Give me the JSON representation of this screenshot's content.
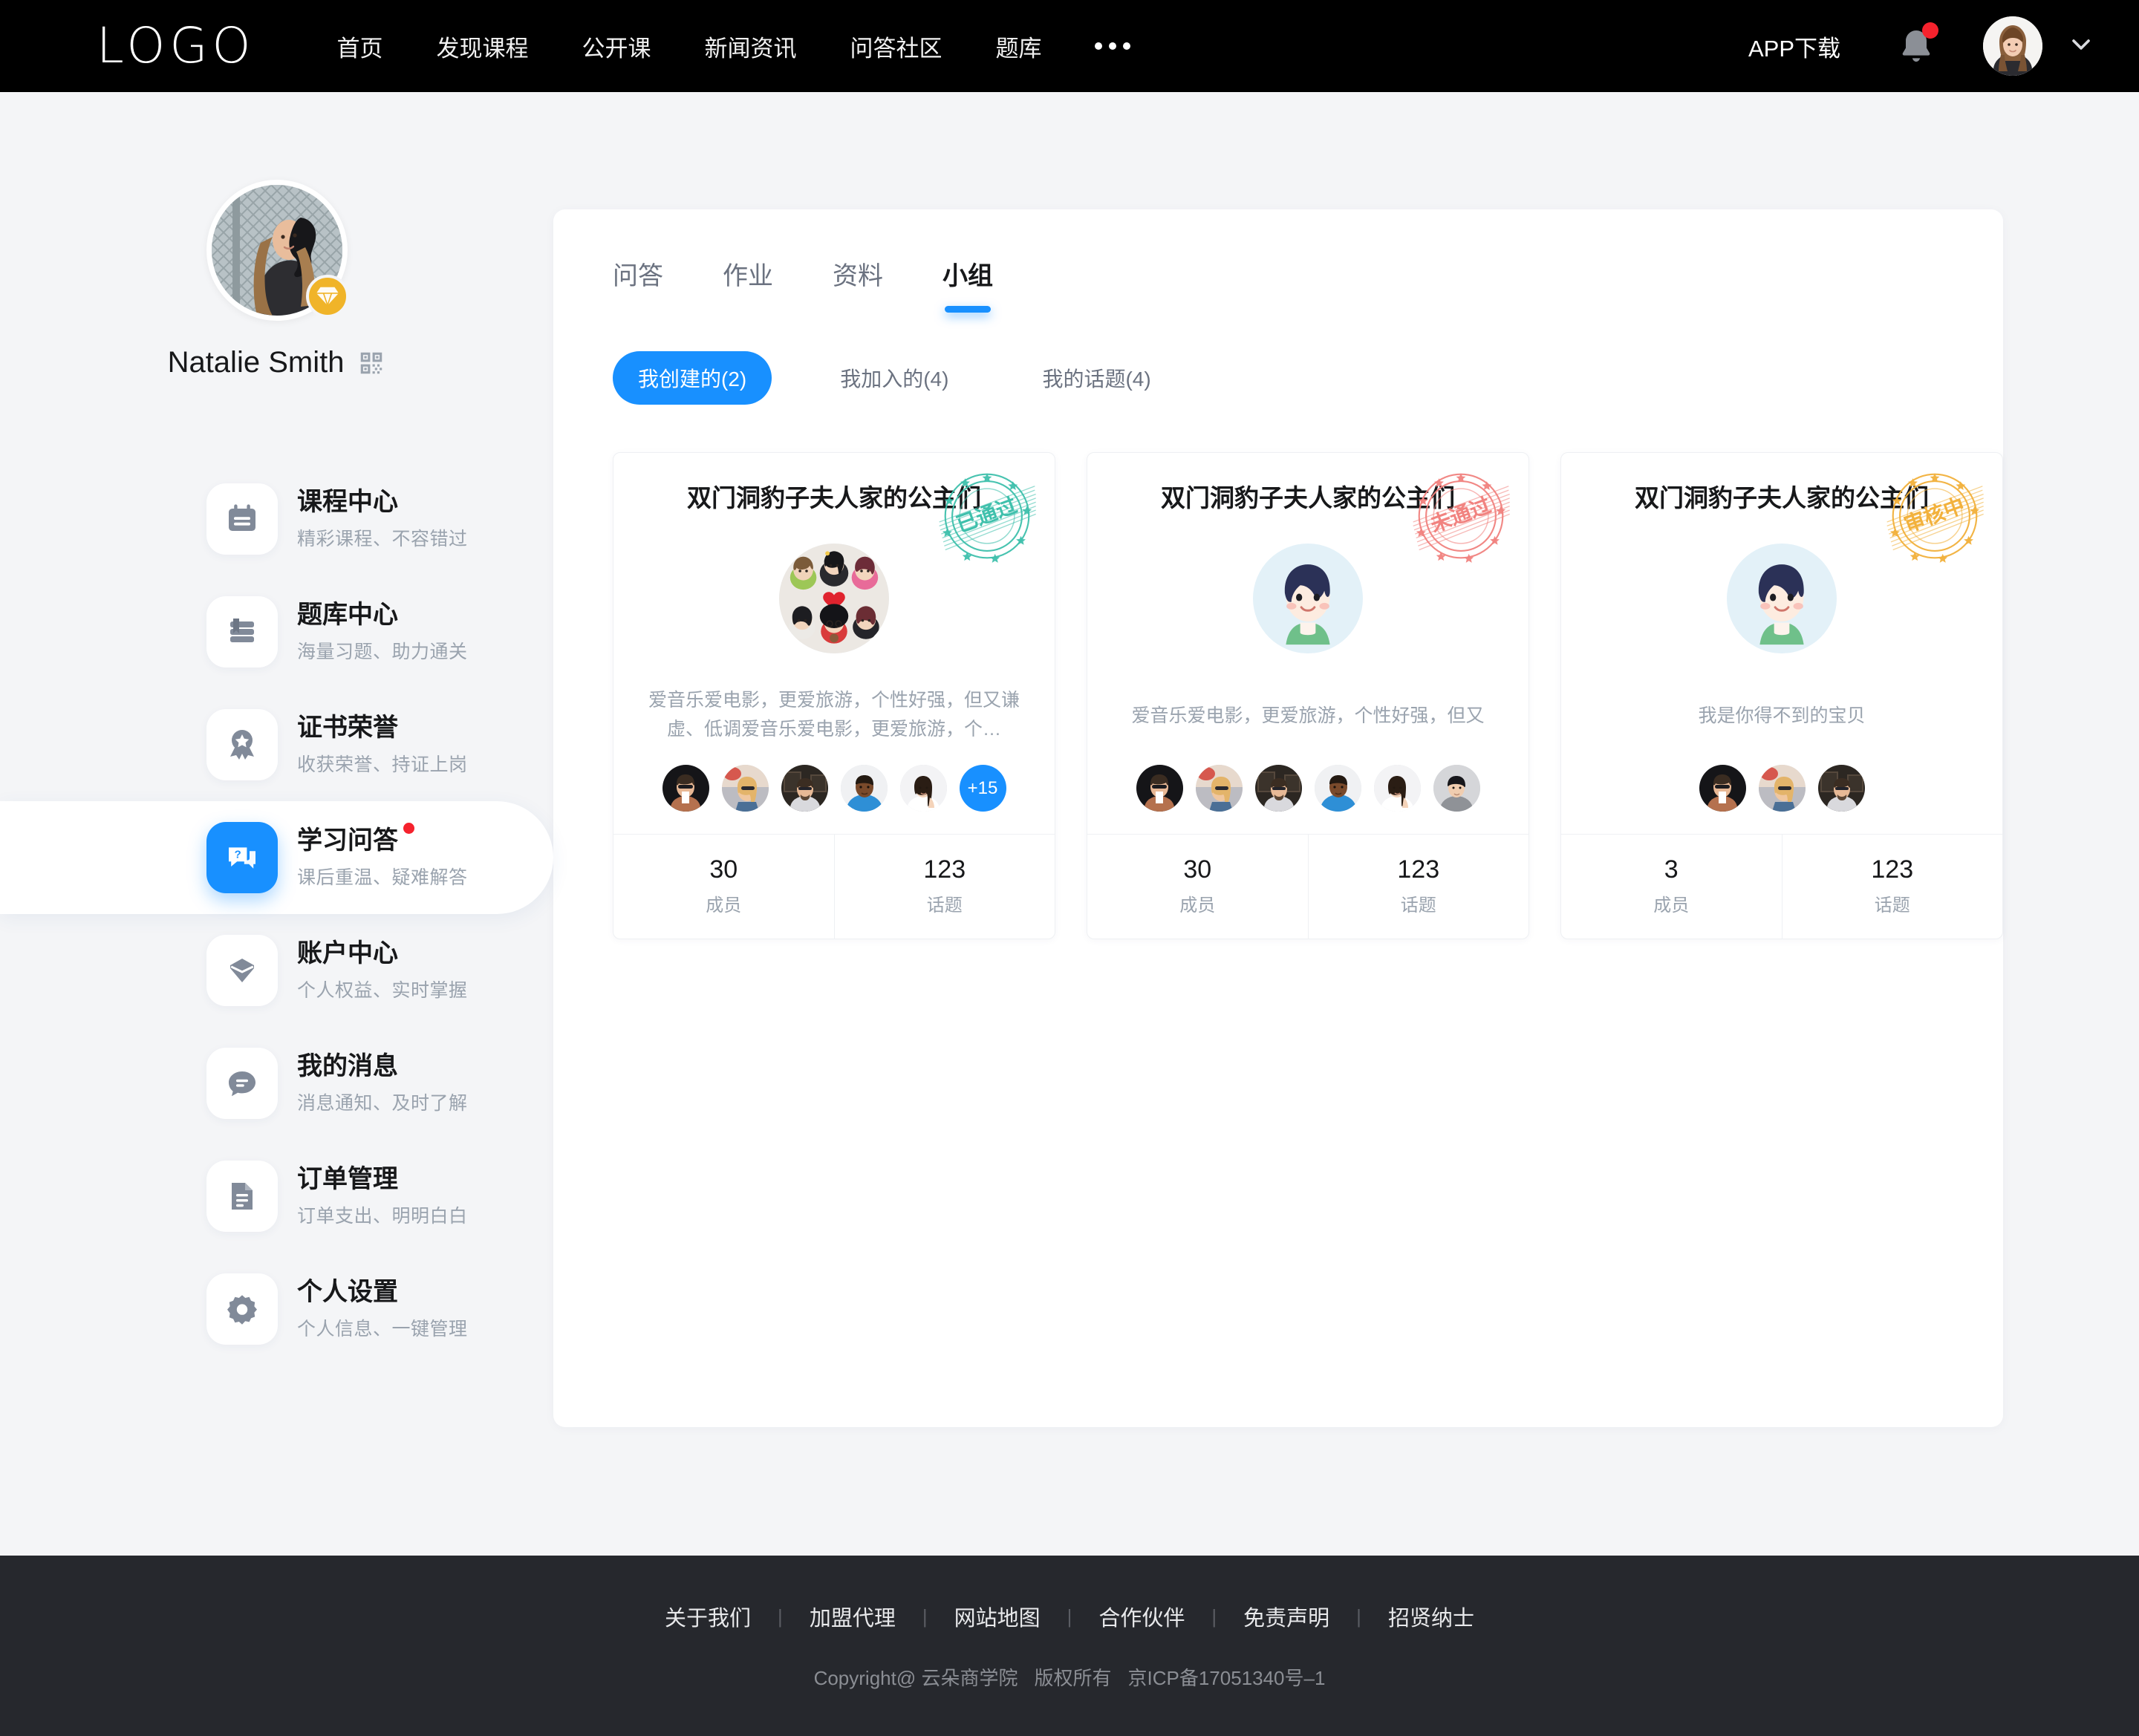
{
  "header": {
    "logo": "LOGO",
    "nav": [
      {
        "label": "首页"
      },
      {
        "label": "发现课程"
      },
      {
        "label": "公开课"
      },
      {
        "label": "新闻资讯"
      },
      {
        "label": "问答社区"
      },
      {
        "label": "题库"
      }
    ],
    "more_icon": "ellipsis-icon",
    "app_download": "APP下载",
    "bell_icon": "bell-icon",
    "bell_has_badge": true,
    "avatar_icon": "user-avatar",
    "chevron_icon": "chevron-down-icon"
  },
  "sidebar": {
    "profile": {
      "name": "Natalie Smith",
      "vip_icon": "diamond-icon",
      "qr_icon": "qrcode-icon"
    },
    "items": [
      {
        "title": "课程中心",
        "sub": "精彩课程、不容错过",
        "icon": "calendar-icon",
        "active": false,
        "badge": false
      },
      {
        "title": "题库中心",
        "sub": "海量习题、助力通关",
        "icon": "books-icon",
        "active": false,
        "badge": false
      },
      {
        "title": "证书荣誉",
        "sub": "收获荣誉、持证上岗",
        "icon": "medal-icon",
        "active": false,
        "badge": false
      },
      {
        "title": "学习问答",
        "sub": "课后重温、疑难解答",
        "icon": "question-chat-icon",
        "active": true,
        "badge": true
      },
      {
        "title": "账户中心",
        "sub": "个人权益、实时掌握",
        "icon": "diamond-icon",
        "active": false,
        "badge": false
      },
      {
        "title": "我的消息",
        "sub": "消息通知、及时了解",
        "icon": "message-icon",
        "active": false,
        "badge": false
      },
      {
        "title": "订单管理",
        "sub": "订单支出、明明白白",
        "icon": "document-icon",
        "active": false,
        "badge": false
      },
      {
        "title": "个人设置",
        "sub": "个人信息、一键管理",
        "icon": "gear-icon",
        "active": false,
        "badge": false
      }
    ]
  },
  "main": {
    "tabs": [
      {
        "label": "问答",
        "active": false
      },
      {
        "label": "作业",
        "active": false
      },
      {
        "label": "资料",
        "active": false
      },
      {
        "label": "小组",
        "active": true
      }
    ],
    "filters": [
      {
        "label": "我创建的(2)",
        "active": true
      },
      {
        "label": "我加入的(4)",
        "active": false
      },
      {
        "label": "我的话题(4)",
        "active": false
      }
    ],
    "cards": [
      {
        "title": "双门洞豹子夫人家的公主们",
        "stamp_text": "已通过",
        "stamp_color": "#3fc0ac",
        "avatar_kind": "group-collage",
        "desc": "爱音乐爱电影，更爱旅游，个性好强，但又谦虚、低调爱音乐爱电影，更爱旅游，个…",
        "member_count_more": "+15",
        "members": [
          "m1",
          "m2",
          "m3",
          "m4",
          "m5"
        ],
        "stats": [
          {
            "num": "30",
            "label": "成员"
          },
          {
            "num": "123",
            "label": "话题"
          }
        ]
      },
      {
        "title": "双门洞豹子夫人家的公主们",
        "stamp_text": "未通过",
        "stamp_color": "#f1827f",
        "avatar_kind": "boy",
        "desc": "爱音乐爱电影，更爱旅游，个性好强，但又",
        "member_count_more": "",
        "members": [
          "m1",
          "m2",
          "m3",
          "m4",
          "m5",
          "m6"
        ],
        "stats": [
          {
            "num": "30",
            "label": "成员"
          },
          {
            "num": "123",
            "label": "话题"
          }
        ]
      },
      {
        "title": "双门洞豹子夫人家的公主们",
        "stamp_text": "审核中",
        "stamp_color": "#f2b13c",
        "avatar_kind": "boy",
        "desc": "我是你得不到的宝贝",
        "member_count_more": "",
        "members": [
          "m1",
          "m2",
          "m3"
        ],
        "stats": [
          {
            "num": "3",
            "label": "成员"
          },
          {
            "num": "123",
            "label": "话题"
          }
        ]
      }
    ]
  },
  "footer": {
    "links": [
      "关于我们",
      "加盟代理",
      "网站地图",
      "合作伙伴",
      "免责声明",
      "招贤纳士"
    ],
    "separator": "|",
    "copyright": "Copyright@ 云朵商学院",
    "rights": "版权所有",
    "icp": "京ICP备17051340号–1"
  },
  "colors": {
    "accent": "#1890ff",
    "dark": "#000000",
    "footer_bg": "#26282d",
    "page_bg": "#f4f5f7"
  }
}
